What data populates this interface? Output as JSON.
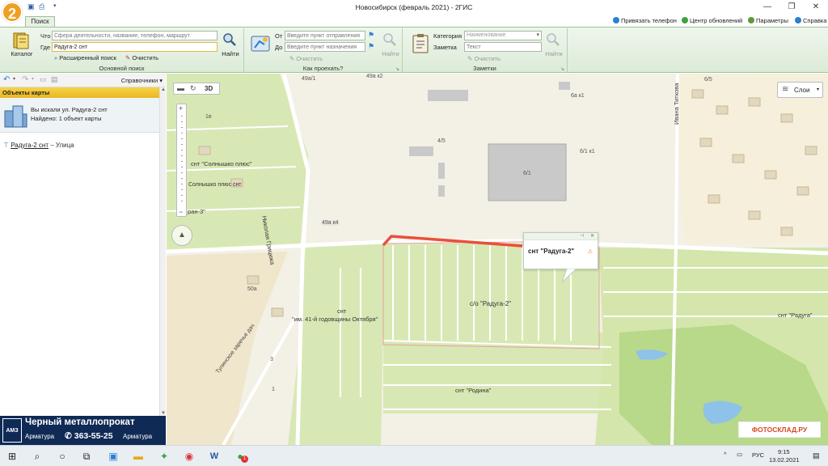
{
  "window": {
    "title": "Новосибирск (февраль 2021) - 2ГИС",
    "logo_text": "2"
  },
  "tabs": {
    "search": "Поиск"
  },
  "top_links": {
    "phone": "Привязать телефон",
    "updates": "Центр обновлений",
    "params": "Параметры",
    "help": "Справка"
  },
  "ribbon": {
    "search_group": {
      "catalog": "Каталог",
      "what_label": "Что",
      "what_placeholder": "Сфера деятельности, название, телефон, маршрут",
      "where_label": "Где",
      "where_value": "Радуга-2 снт",
      "find": "Найти",
      "advanced": "Расширенный поиск",
      "clear": "Очистить",
      "label": "Основной поиск"
    },
    "route_group": {
      "from_label": "От",
      "from_placeholder": "Введите пункт отправления",
      "to_label": "До",
      "to_placeholder": "Введите пункт назначения",
      "clear": "Очистить",
      "find": "Найти",
      "label": "Как проехать?"
    },
    "notes_group": {
      "category_label": "Категория",
      "category_placeholder": "Наименование",
      "note_label": "Заметка",
      "note_placeholder": "Текст",
      "clear": "Очистить",
      "find": "Найти",
      "label": "Заметки"
    }
  },
  "left_panel": {
    "directories": "Справочники",
    "header": "Объекты карты",
    "searched": "Вы искали ул. Радуга-2 снт",
    "found": "Найдено: 1 объект карты",
    "result_name": "Радуга-2 снт",
    "result_type": "– Улица"
  },
  "ad": {
    "title": "Черный металлопрокат",
    "left_text": "Арматура",
    "phone": "363-55-25",
    "right_text": "Арматура",
    "logo": "АМЗ"
  },
  "map": {
    "layers_button": "Слои",
    "view_3d": "3D",
    "popup_title": "снт \"Радуга-2\"",
    "watermark": "ФОТОСКЛАД.РУ",
    "labels": [
      "49а/1",
      "49а к2",
      "6а к1",
      "6/5",
      "4/5",
      "6/1",
      "6/1 к1",
      "снт \"Солнышко плюс\"",
      "Солнышко плюс снт",
      "ран-3\"",
      "49а к4",
      "Николая Грицюка",
      "Ивана Титкова",
      "50а",
      "снт",
      "\"им. 41-й годовщины Октября\"",
      "с/о \"Радуга-2\"",
      "снт \"Радуга\"",
      "снт \"Родина\"",
      "Тулинское заречье дач",
      "3",
      "1",
      "1в"
    ]
  },
  "taskbar": {
    "lang": "РУС",
    "time": "9:15",
    "date": "13.02.2021",
    "badge": "1"
  },
  "colors": {
    "ribbon": "#dcebd8",
    "panel_header": "#e8b820",
    "route_highlight": "#e8503a",
    "ad_bg": "#0f2a55",
    "map_green": "#cfe3a9",
    "map_land": "#f3f0e6"
  }
}
